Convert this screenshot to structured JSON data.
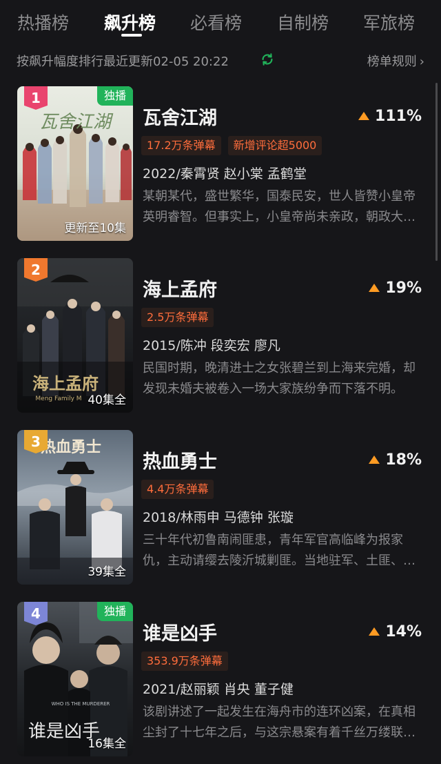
{
  "tabs": [
    {
      "label": "热播榜"
    },
    {
      "label": "飙升榜"
    },
    {
      "label": "必看榜"
    },
    {
      "label": "自制榜"
    },
    {
      "label": "军旅榜"
    }
  ],
  "active_tab": 1,
  "subbar": {
    "update_text": "按飙升幅度排行最近更新02-05 20:22",
    "refresh_icon": "refresh-icon",
    "rules_label": "榜单规则",
    "rules_chevron": "›"
  },
  "colors": {
    "background": "#161619",
    "accent_green": "#21b35a",
    "trend_orange": "#ff9b23",
    "tag_text": "#ff6d3c",
    "rank_colors": [
      "#e9446e",
      "#f0782e",
      "#e8a933",
      "#7d86d6"
    ]
  },
  "items": [
    {
      "rank": "1",
      "exclusive": "独播",
      "episodes": "更新至10集",
      "title": "瓦舍江湖",
      "trend": "111%",
      "tags": [
        "17.2万条弹幕",
        "新增评论超5000"
      ],
      "meta": "2022/秦霄贤 赵小棠 孟鹤堂",
      "desc": "某朝某代，盛世繁华，国泰民安，世人皆赞小皇帝 英明睿智。但事实上，小皇帝尚未亲政，朝政大权尽在摄政王手中。",
      "poster_title": "瓦舍江湖"
    },
    {
      "rank": "2",
      "exclusive": "",
      "episodes": "40集全",
      "title": "海上孟府",
      "trend": "19%",
      "tags": [
        "2.5万条弹幕"
      ],
      "meta": "2015/陈冲 段奕宏 廖凡",
      "desc": "民国时期，晚清进士之女张碧兰到上海来完婚，却发现未婚夫被卷入一场大家族纷争而下落不明。",
      "poster_title": "海上孟府",
      "poster_subtitle": "Meng Family M"
    },
    {
      "rank": "3",
      "exclusive": "",
      "episodes": "39集全",
      "title": "热血勇士",
      "trend": "18%",
      "tags": [
        "4.4万条弹幕"
      ],
      "meta": "2018/林雨申 马德钟 张璇",
      "desc": "三十年代初鲁南闹匪患，青年军官高临峰为报家仇，主动请缨去陵沂城剿匪。当地驻军、土匪、日寇各方势力暗流涌动。",
      "poster_title": "热血勇士"
    },
    {
      "rank": "4",
      "exclusive": "独播",
      "episodes": "16集全",
      "title": "谁是凶手",
      "trend": "14%",
      "tags": [
        "353.9万条弹幕"
      ],
      "meta": "2021/赵丽颖 肖央 董子健",
      "desc": "该剧讲述了一起发生在海舟市的连环凶案，在真相尘封了十七年之后，与这宗悬案有着千丝万缕联系的人们再度聚首。",
      "poster_title": "谁是凶手",
      "poster_subtitle": "WHO IS THE MURDERER"
    }
  ]
}
